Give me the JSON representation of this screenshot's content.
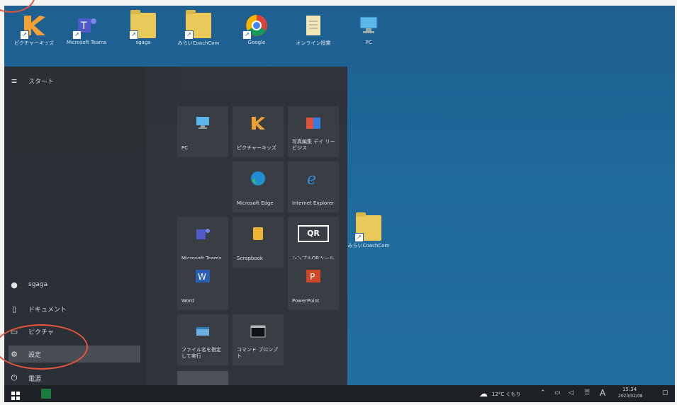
{
  "desktop_icons": [
    {
      "label": "ピクチャーキッズ"
    },
    {
      "label": "Microsoft Teams"
    },
    {
      "label": "sgaga"
    },
    {
      "label": "みらいCoachCom"
    },
    {
      "label": "Google"
    },
    {
      "label": "オンライン授業"
    },
    {
      "label": "PC"
    }
  ],
  "desktop_folder_mid": {
    "label": "みらいCoachCom"
  },
  "start_menu": {
    "title": "スタート",
    "left_items": [
      {
        "label": "sgaga"
      },
      {
        "label": "ドキュメント"
      },
      {
        "label": "ピクチャ"
      },
      {
        "label": "設定"
      },
      {
        "label": "電源"
      }
    ],
    "tiles": [
      {
        "label": "PC"
      },
      {
        "label": "ピクチャーキッズ"
      },
      {
        "label": "写真編集 デイ リービジス"
      },
      {
        "label": "Microsoft Edge"
      },
      {
        "label": "Internet Explorer"
      },
      {
        "label": "Microsoft Teams"
      },
      {
        "label": "Scrapbook"
      },
      {
        "label": "シンプルQRツール"
      },
      {
        "label": "Word"
      },
      {
        "label": "PowerPoint"
      },
      {
        "label": "ファイル名を指定して実行"
      },
      {
        "label": "コマンド プロンプト"
      }
    ],
    "qr_text": "QR"
  },
  "taskbar": {
    "weather": "12°C くもり",
    "ime": "A",
    "time": "15:34",
    "date": "2023/02/08"
  },
  "colors": {
    "annotation": "#e5553e",
    "desktop": "#1f6a9c"
  }
}
